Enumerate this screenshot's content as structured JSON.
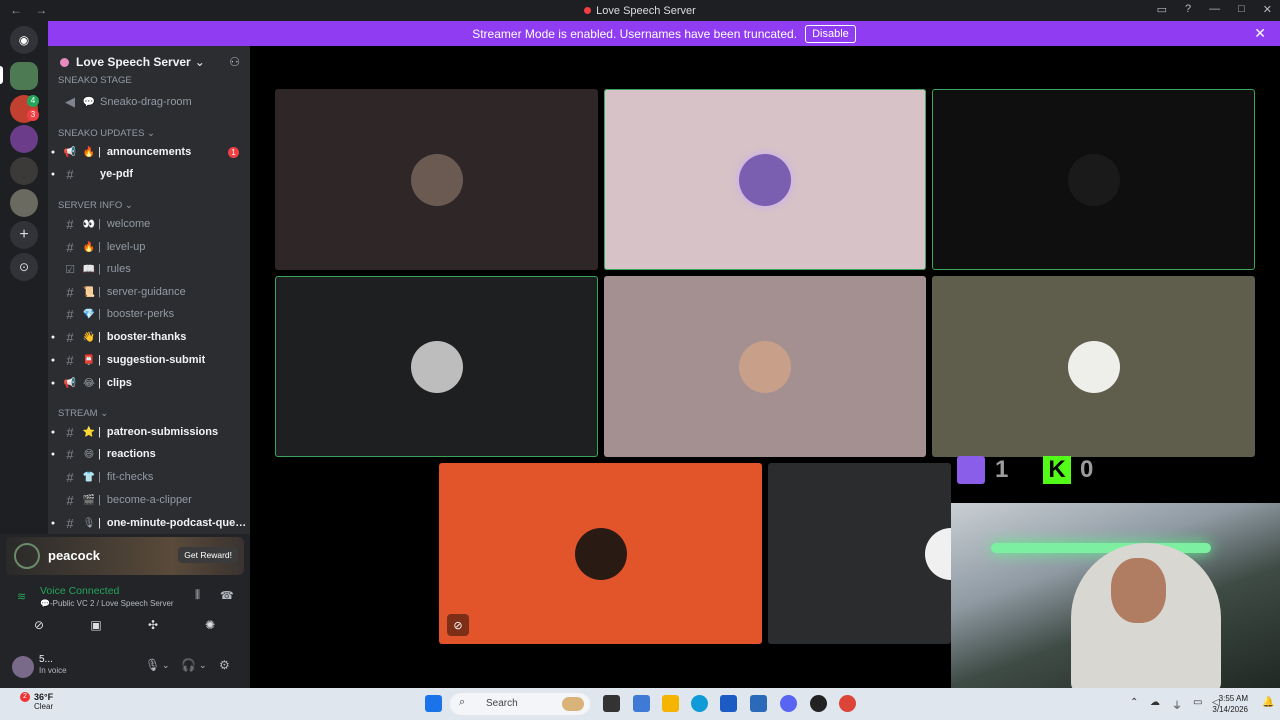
{
  "window": {
    "title": "Love Speech Server",
    "back": "←",
    "forward": "→"
  },
  "banner": {
    "text": "Streamer Mode is enabled. Usernames have been truncated.",
    "button": "Disable",
    "close": "✕"
  },
  "rail": {
    "badges": [
      "4",
      "3"
    ]
  },
  "server": {
    "name": "Love Speech Server",
    "chevron": "⌄"
  },
  "sidebar": {
    "cut_category": "SNEAKO STAGE",
    "cut_channel": "Sneako-drag-room",
    "categories": {
      "updates": "SNEAKO UPDATES",
      "info": "SERVER INFO",
      "stream": "STREAM"
    },
    "channels": [
      {
        "label": "announcements",
        "emoji": "🔥",
        "type": "announce",
        "unread": true,
        "mentions": "1"
      },
      {
        "label": "ye-pdf",
        "emoji": "",
        "type": "text",
        "unread": true
      },
      {
        "label": "welcome",
        "emoji": "👀",
        "type": "text",
        "unread": false
      },
      {
        "label": "level-up",
        "emoji": "🔥",
        "type": "text",
        "unread": false
      },
      {
        "label": "rules",
        "emoji": "📖",
        "type": "rules",
        "unread": false
      },
      {
        "label": "server-guidance",
        "emoji": "📜",
        "type": "text",
        "unread": false
      },
      {
        "label": "booster-perks",
        "emoji": "💎",
        "type": "text",
        "unread": false
      },
      {
        "label": "booster-thanks",
        "emoji": "👋",
        "type": "text",
        "unread": true
      },
      {
        "label": "suggestion-submit",
        "emoji": "📮",
        "type": "text",
        "unread": true
      },
      {
        "label": "clips",
        "emoji": "😂",
        "type": "announce",
        "unread": true
      },
      {
        "label": "patreon-submissions",
        "emoji": "⭐",
        "type": "text",
        "unread": true
      },
      {
        "label": "reactions",
        "emoji": "😄",
        "type": "text",
        "unread": true
      },
      {
        "label": "fit-checks",
        "emoji": "👕",
        "type": "text",
        "unread": false
      },
      {
        "label": "become-a-clipper",
        "emoji": "🎬",
        "type": "text",
        "unread": false
      },
      {
        "label": "one-minute-podcast-quest...",
        "emoji": "🎙",
        "type": "text",
        "unread": true
      }
    ]
  },
  "promo": {
    "brand": "peacock",
    "cta": "Get Reward!"
  },
  "voice": {
    "status": "Voice Connected",
    "channel": "💬-Public VC 2 / Love Speech Server"
  },
  "user": {
    "name": "5...",
    "status": "In voice"
  },
  "overlay": {
    "twitch_count": "1",
    "kick_letter": "K",
    "kick_count": "0"
  },
  "taskbar": {
    "temp": "36°F",
    "condition": "Clear",
    "search": "Search",
    "time": "3:55 AM",
    "date": "3/14/2026",
    "notif": "2"
  },
  "colors": {
    "banner": "#8f3cf3",
    "speaking": "#3ba55d",
    "voice_green": "#23a55a",
    "tile_orange": "#e2542a"
  }
}
